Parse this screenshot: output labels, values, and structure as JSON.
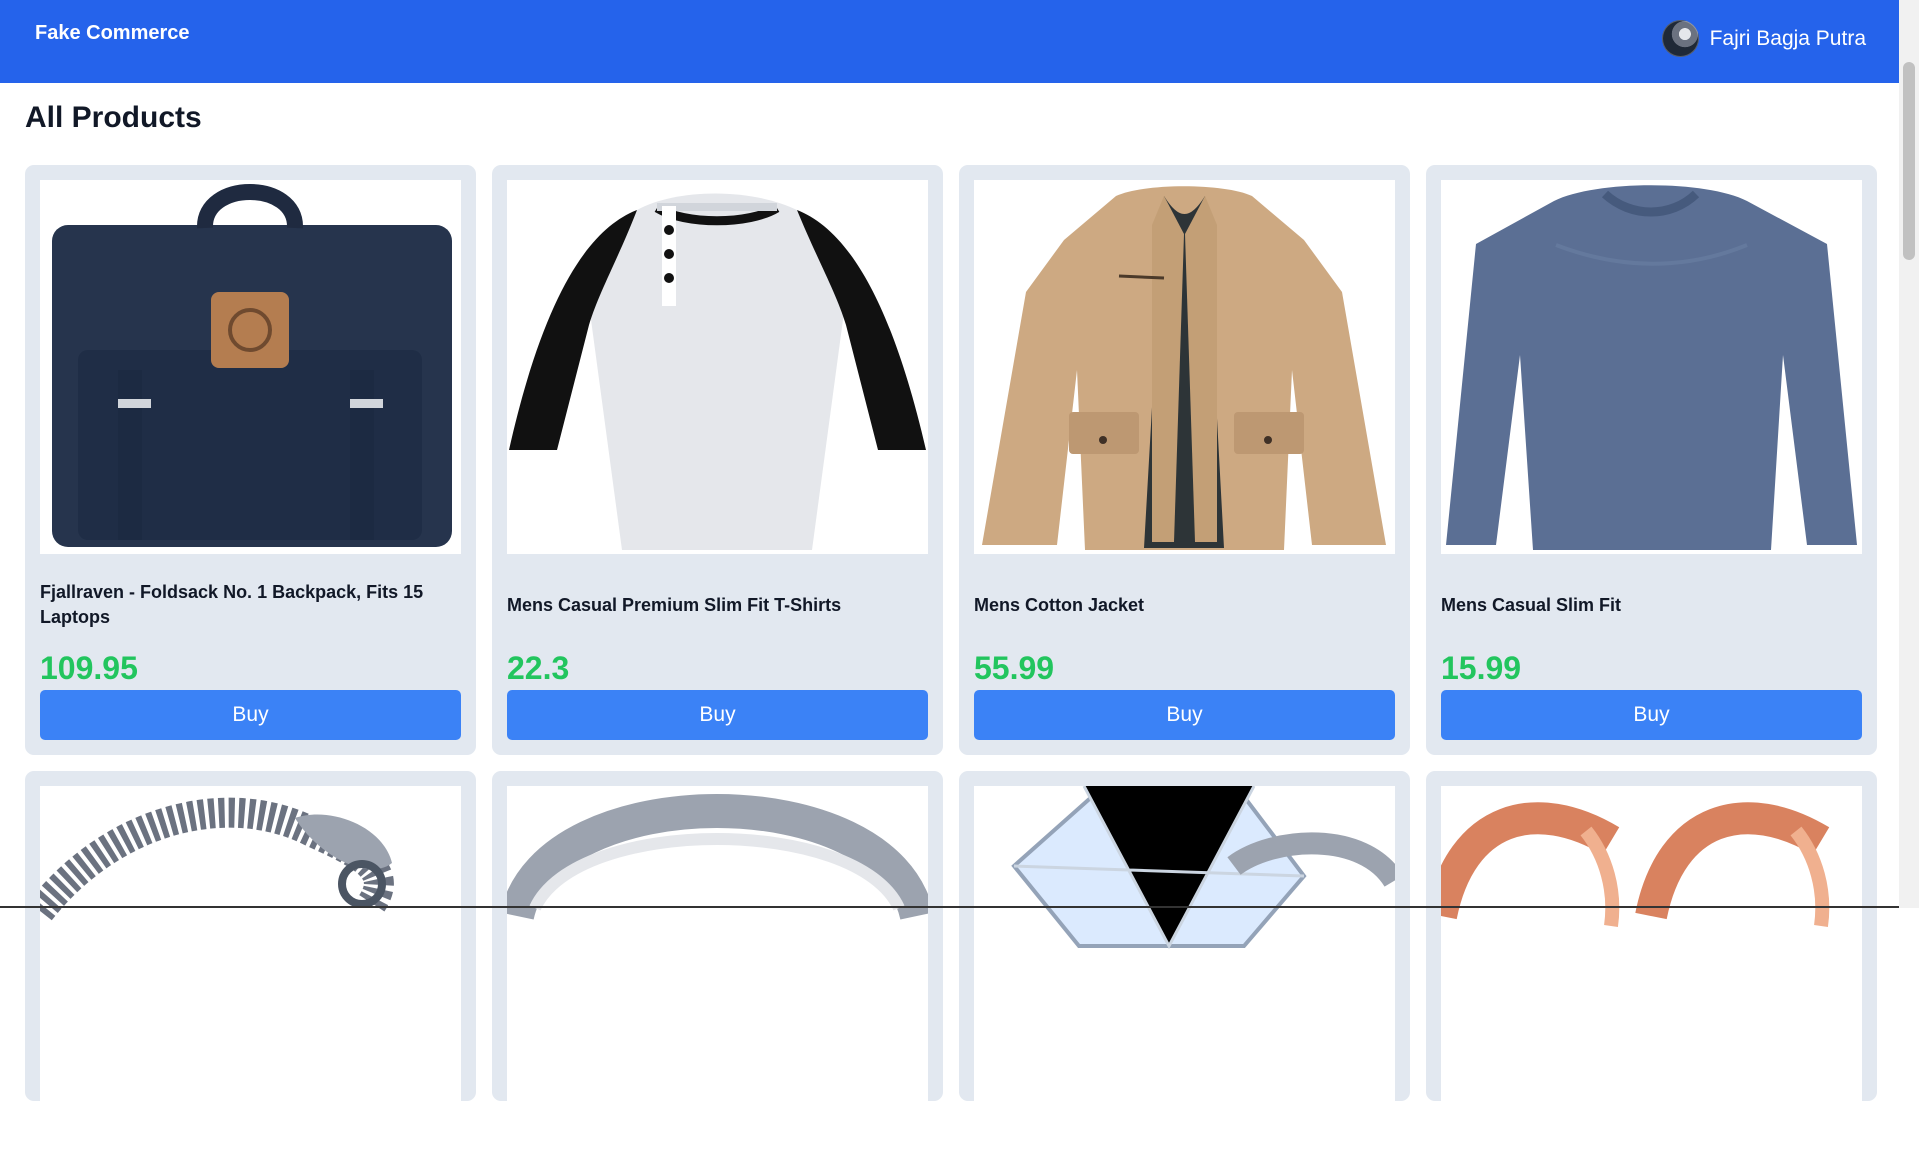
{
  "header": {
    "brand": "Fake Commerce",
    "user_name": "Fajri Bagja Putra",
    "color": "#2563eb"
  },
  "page": {
    "title": "All Products"
  },
  "products": [
    {
      "name": "Fjallraven - Foldsack No. 1 Backpack, Fits 15 Laptops",
      "price": "109.95",
      "button": "Buy",
      "image_icon": "backpack-icon"
    },
    {
      "name": "Mens Casual Premium Slim Fit T-Shirts",
      "price": "22.3",
      "button": "Buy",
      "image_icon": "raglan-shirt-icon"
    },
    {
      "name": "Mens Cotton Jacket",
      "price": "55.99",
      "button": "Buy",
      "image_icon": "jacket-icon"
    },
    {
      "name": "Mens Casual Slim Fit",
      "price": "15.99",
      "button": "Buy",
      "image_icon": "long-sleeve-shirt-icon"
    },
    {
      "image_icon": "dragon-bracelet-icon"
    },
    {
      "image_icon": "silver-ring-icon"
    },
    {
      "image_icon": "diamond-ring-icon"
    },
    {
      "image_icon": "rose-gold-rings-icon"
    }
  ],
  "colors": {
    "card_background": "#e2e8f0",
    "price": "#22c55e",
    "buy_button": "#3b82f6"
  }
}
